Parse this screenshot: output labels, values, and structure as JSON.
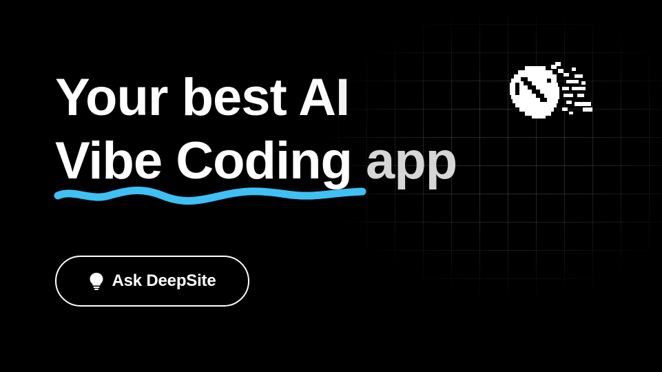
{
  "hero": {
    "headline_line1": "Your best AI",
    "headline_line2_emphasis": "Vibe Coding",
    "headline_line2_tail": " app",
    "cta_label": "Ask DeepSite",
    "cta_icon": "lightbulb-icon",
    "logo_icon": "deepsite-pixel-whale-logo"
  },
  "colors": {
    "background": "#000000",
    "text": "#ffffff",
    "accent_underline": "#3ec0f5",
    "grid_line": "#2a2a2a"
  }
}
